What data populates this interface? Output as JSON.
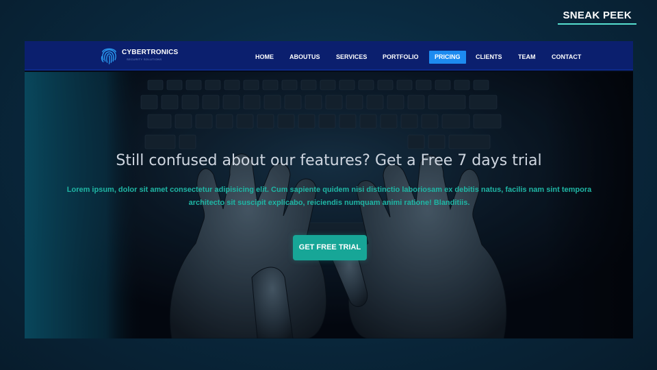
{
  "badge": {
    "label": "SNEAK PEEK"
  },
  "brand": {
    "name": "CYBERTRONICS",
    "tagline": "SECURITY SOLUTIONS",
    "icon": "fingerprint-icon"
  },
  "nav": {
    "items": [
      {
        "label": "HOME"
      },
      {
        "label": "ABOUTUS"
      },
      {
        "label": "SERVICES"
      },
      {
        "label": "PORTFOLIO"
      },
      {
        "label": "PRICING"
      },
      {
        "label": "CLIENTS"
      },
      {
        "label": "TEAM"
      },
      {
        "label": "CONTACT"
      }
    ],
    "active": "PRICING"
  },
  "hero": {
    "title": "Still confused about our features? Get a Free 7 days trial",
    "text": "Lorem ipsum, dolor sit amet consectetur adipisicing elit. Cum sapiente quidem nisi distinctio laboriosam ex debitis natus, facilis nam sint tempora architecto sit suscipit explicabo, reiciendis numquam animi ratione! Blanditiis.",
    "cta_label": "GET FREE TRIAL",
    "background": "hands-typing-on-keyboard-image"
  },
  "colors": {
    "navbar": "#0b1f6e",
    "active_nav": "#1d8bf0",
    "accent": "#17a697",
    "hero_text": "#1fb5a4",
    "badge_underline": "#56e0d0"
  }
}
